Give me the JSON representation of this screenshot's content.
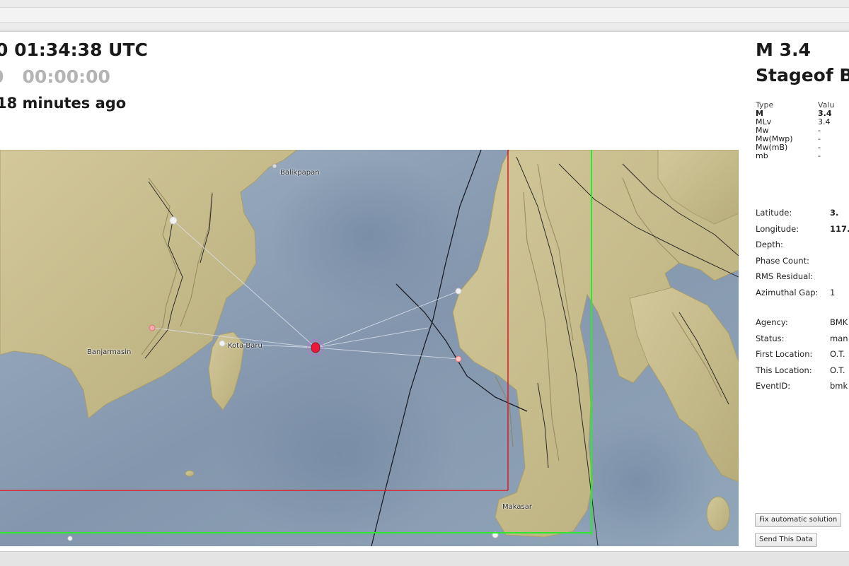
{
  "header": {
    "time_utc": "0 01:34:38 UTC",
    "time_local_left": "0",
    "time_local": "00:00:00",
    "time_ago": "18 minutes ago"
  },
  "map": {
    "cities": {
      "balikpapan": "Balikpapan",
      "banjarmasin": "Banjarmasin",
      "kota_baru": "Kota Baru",
      "makasar": "Makasar"
    },
    "colors": {
      "sea": "#8ea2b6",
      "land": "#c9be8e",
      "epicenter": "#e8193c",
      "red_box": "#e0202a",
      "green_box": "#2ee830"
    }
  },
  "event": {
    "magnitude_title": "M 3.4",
    "agency_title": "Stageof B",
    "magnitudes": {
      "header": {
        "type": "Type",
        "value": "Valu"
      },
      "rows": [
        {
          "type": "M",
          "value": "3.4"
        },
        {
          "type": "MLv",
          "value": "3.4"
        },
        {
          "type": "Mw",
          "value": "-"
        },
        {
          "type": "Mw(Mwp)",
          "value": "-"
        },
        {
          "type": "Mw(mB)",
          "value": "-"
        },
        {
          "type": "mb",
          "value": "-"
        }
      ]
    },
    "location": [
      {
        "key": "Latitude:",
        "value": "3."
      },
      {
        "key": "Longitude:",
        "value": "117."
      },
      {
        "key": "Depth:",
        "value": ""
      },
      {
        "key": "Phase Count:",
        "value": ""
      },
      {
        "key": "RMS Residual:",
        "value": ""
      },
      {
        "key": "Azimuthal Gap:",
        "value": "1"
      }
    ],
    "source": [
      {
        "key": "Agency:",
        "value": "BMK"
      },
      {
        "key": "Status:",
        "value": "man"
      },
      {
        "key": "First Location:",
        "value": "O.T."
      },
      {
        "key": "This Location:",
        "value": "O.T."
      },
      {
        "key": "EventID:",
        "value": "bmk"
      }
    ]
  },
  "buttons": {
    "fix_solution": "Fix automatic solution",
    "send_data": "Send This Data"
  }
}
